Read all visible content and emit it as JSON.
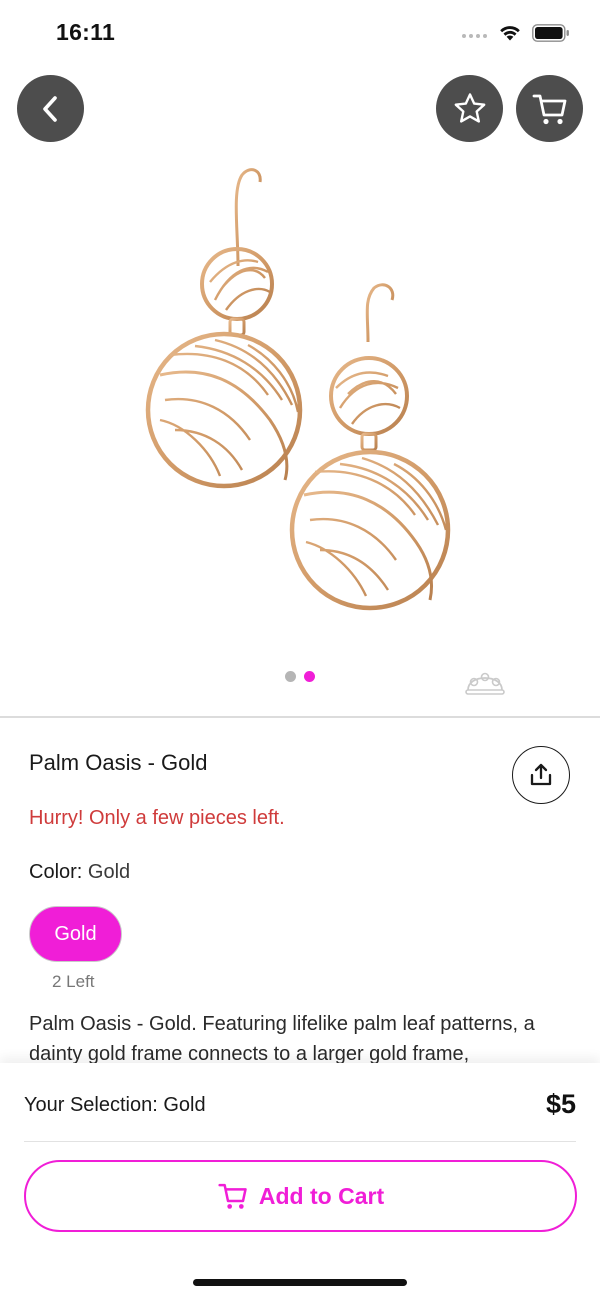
{
  "status_bar": {
    "time": "16:11"
  },
  "header": {
    "back_icon": "chevron-left-icon",
    "favorite_icon": "star-icon",
    "cart_icon": "cart-icon",
    "button_color": "#4d4d4d"
  },
  "product": {
    "title": "Palm Oasis - Gold",
    "stock_warning": "Hurry! Only a few pieces left.",
    "color_label": "Color: ",
    "color_value": "Gold",
    "color_options": [
      {
        "label": "Gold",
        "stock": "2 Left",
        "selected": true
      }
    ],
    "description": "Palm Oasis - Gold. Featuring lifelike palm leaf patterns, a dainty gold frame connects to a larger gold frame,",
    "image_count": 2,
    "active_image_index": 1
  },
  "bottom_bar": {
    "selection_label": "Your Selection: Gold",
    "price": "$5",
    "add_to_cart_label": "Add to Cart"
  },
  "colors": {
    "accent": "#f01ed7",
    "warning": "#cf3b3b"
  }
}
